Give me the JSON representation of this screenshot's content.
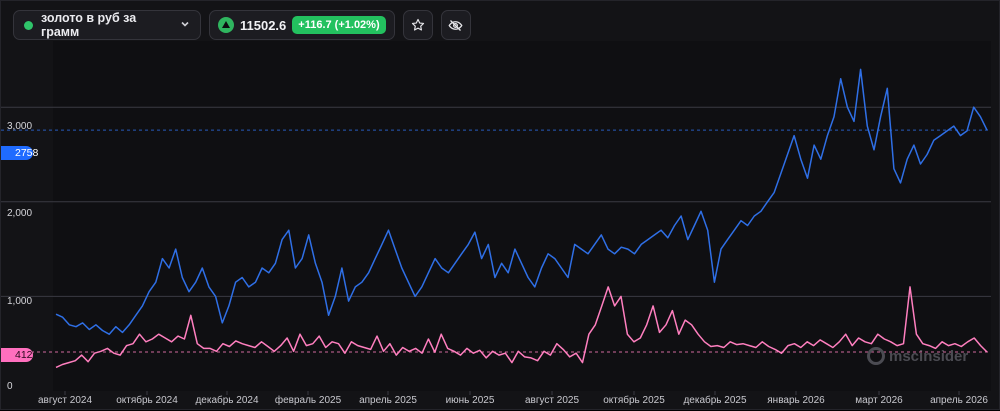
{
  "header": {
    "symbol_label": "золото в руб за грамм",
    "price": "11502.6",
    "change": "+116.7 (+1.02%)",
    "status_color": "#2fc46a",
    "icons": [
      "chevron-down-icon",
      "up-triangle-icon",
      "star-icon",
      "eye-off-icon"
    ]
  },
  "watermark": "mscinsider",
  "chart_data": {
    "type": "line",
    "x_tick_labels": [
      "август 2024",
      "октябрь 2024",
      "декабрь 2024",
      "февраль 2025",
      "апрель 2025",
      "июнь 2025",
      "август 2025",
      "октябрь 2025",
      "декабрь 2025",
      "январь 2026",
      "март 2026",
      "апрель 2026"
    ],
    "y_tick_labels": [
      "0",
      "1,000",
      "2,000",
      "3,000"
    ],
    "ylim": [
      0,
      3700
    ],
    "grid": true,
    "series": [
      {
        "color": "#2f6fe6",
        "last_value_label": "2758",
        "values": [
          812,
          780,
          700,
          680,
          720,
          650,
          700,
          640,
          600,
          680,
          620,
          700,
          800,
          900,
          1050,
          1150,
          1400,
          1300,
          1500,
          1200,
          1050,
          1150,
          1300,
          1100,
          1000,
          720,
          900,
          1150,
          1200,
          1100,
          1150,
          1300,
          1250,
          1350,
          1600,
          1700,
          1300,
          1400,
          1650,
          1350,
          1150,
          800,
          1000,
          1300,
          950,
          1100,
          1150,
          1250,
          1400,
          1550,
          1700,
          1500,
          1300,
          1150,
          1000,
          1100,
          1250,
          1400,
          1300,
          1250,
          1350,
          1450,
          1550,
          1680,
          1400,
          1550,
          1200,
          1350,
          1250,
          1500,
          1350,
          1200,
          1100,
          1300,
          1450,
          1400,
          1300,
          1200,
          1550,
          1500,
          1450,
          1550,
          1650,
          1500,
          1450,
          1520,
          1500,
          1450,
          1550,
          1600,
          1650,
          1700,
          1620,
          1750,
          1850,
          1600,
          1750,
          1900,
          1700,
          1150,
          1500,
          1600,
          1700,
          1800,
          1750,
          1850,
          1900,
          2000,
          2100,
          2300,
          2500,
          2700,
          2450,
          2250,
          2600,
          2450,
          2700,
          2900,
          3300,
          3000,
          2850,
          3400,
          2800,
          2550,
          2900,
          3200,
          2350,
          2200,
          2450,
          2600,
          2400,
          2500,
          2650,
          2700,
          2750,
          2800,
          2700,
          2750,
          3000,
          2900,
          2758
        ]
      },
      {
        "color": "#ff7fbf",
        "last_value_label": "412",
        "values": [
          250,
          280,
          300,
          320,
          380,
          310,
          400,
          420,
          450,
          400,
          380,
          480,
          500,
          600,
          520,
          550,
          600,
          560,
          520,
          580,
          550,
          800,
          500,
          450,
          450,
          420,
          500,
          470,
          530,
          500,
          480,
          460,
          520,
          470,
          420,
          480,
          560,
          420,
          600,
          480,
          500,
          580,
          460,
          520,
          500,
          400,
          520,
          480,
          460,
          440,
          580,
          420,
          500,
          380,
          460,
          420,
          450,
          400,
          550,
          410,
          600,
          450,
          420,
          380,
          450,
          400,
          430,
          350,
          420,
          380,
          400,
          300,
          420,
          360,
          350,
          320,
          420,
          380,
          500,
          440,
          360,
          400,
          300,
          600,
          700,
          900,
          1100,
          900,
          1000,
          600,
          520,
          560,
          700,
          900,
          620,
          700,
          850,
          600,
          750,
          700,
          600,
          520,
          470,
          480,
          460,
          520,
          490,
          500,
          480,
          460,
          520,
          470,
          440,
          400,
          480,
          500,
          460,
          520,
          480,
          540,
          500,
          460,
          520,
          600,
          480,
          560,
          520,
          500,
          600,
          550,
          520,
          480,
          500,
          1100,
          600,
          500,
          480,
          450,
          520,
          480,
          500,
          470,
          520,
          560,
          480,
          412
        ]
      }
    ]
  }
}
